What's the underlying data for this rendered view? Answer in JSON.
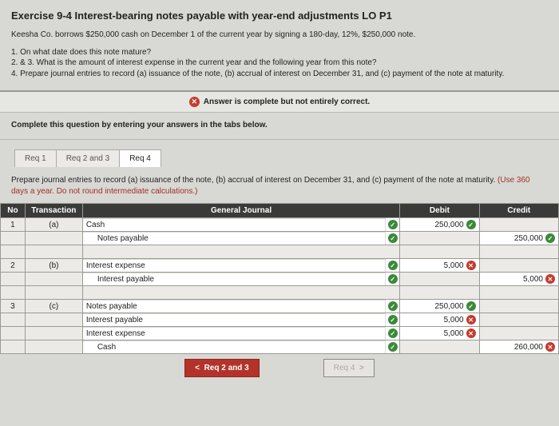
{
  "title": "Exercise 9-4 Interest-bearing notes payable with year-end adjustments LO P1",
  "intro": "Keesha Co. borrows $250,000 cash on December 1 of the current year by signing a 180-day, 12%, $250,000 note.",
  "questions": {
    "q1": "1. On what date does this note mature?",
    "q23": "2. & 3. What is the amount of interest expense in the current year and the following year from this note?",
    "q4": "4. Prepare journal entries to record (a) issuance of the note, (b) accrual of interest on December 31, and (c) payment of the note at maturity."
  },
  "banner": "Answer is complete but not entirely correct.",
  "complete_line": "Complete this question by entering your answers in the tabs below.",
  "tabs": {
    "t1": "Req 1",
    "t2": "Req 2 and 3",
    "t3": "Req 4"
  },
  "prep": {
    "black": "Prepare journal entries to record (a) issuance of the note, (b) accrual of interest on December 31, and (c) payment of the note at maturity. ",
    "red": "(Use 360 days a year. Do not round intermediate calculations.)"
  },
  "hdr": {
    "no": "No",
    "tx": "Transaction",
    "gj": "General Journal",
    "debit": "Debit",
    "credit": "Credit"
  },
  "rows": {
    "r1_no": "1",
    "r1_tx": "(a)",
    "r1_acct": "Cash",
    "r1_debit": "250,000",
    "r2_acct": "Notes payable",
    "r2_credit": "250,000",
    "r3_no": "2",
    "r3_tx": "(b)",
    "r3_acct": "Interest expense",
    "r3_debit": "5,000",
    "r4_acct": "Interest payable",
    "r4_credit": "5,000",
    "r5_no": "3",
    "r5_tx": "(c)",
    "r5_acct": "Notes payable",
    "r5_debit": "250,000",
    "r6_acct": "Interest payable",
    "r6_debit": "5,000",
    "r7_acct": "Interest expense",
    "r7_debit": "5,000",
    "r8_acct": "Cash",
    "r8_credit": "260,000"
  },
  "nav": {
    "prev": "Req 2 and 3",
    "next": "Req 4"
  },
  "glyph": {
    "check": "✓",
    "x": "✕",
    "left": "<",
    "right": ">"
  }
}
